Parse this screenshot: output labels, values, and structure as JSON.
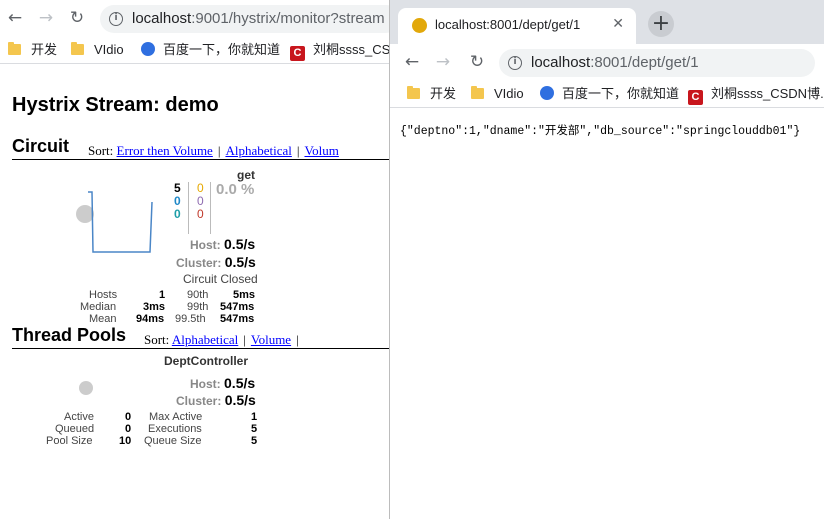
{
  "left_browser": {
    "url_host": "localhost",
    "url_rest": ":9001/hystrix/monitor?stream",
    "bookmarks": [
      "开发",
      "VIdio",
      "百度一下，你就知道",
      "刘桐ssss_CSD"
    ]
  },
  "right_browser": {
    "tab_title": "localhost:8001/dept/get/1",
    "url_host": "localhost",
    "url_rest": ":8001/dept/get/1",
    "bookmarks": [
      "开发",
      "VIdio",
      "百度一下，你就知道",
      "刘桐ssss_CSDN博..."
    ],
    "response_body": "{\"deptno\":1,\"dname\":\"开发部\",\"db_source\":\"springclouddb01\"}"
  },
  "dashboard": {
    "title": "Hystrix Stream: demo",
    "circuit": {
      "section_title": "Circuit",
      "sort_label": "Sort:",
      "sort_links": [
        "Error then Volume",
        "Alphabetical",
        "Volum"
      ],
      "name": "get",
      "counts_left": [
        "5",
        "0",
        "0"
      ],
      "counts_right": [
        "0",
        "0",
        "0"
      ],
      "error_pct": "0.0 %",
      "host_label": "Host:",
      "host_rate": "0.5/s",
      "cluster_label": "Cluster:",
      "cluster_rate": "0.5/s",
      "status": "Circuit Closed",
      "stats": {
        "hosts_label": "Hosts",
        "hosts": "1",
        "median_label": "Median",
        "median": "3ms",
        "mean_label": "Mean",
        "mean": "94ms",
        "p90_label": "90th",
        "p90": "5ms",
        "p99_label": "99th",
        "p99": "547ms",
        "p995_label": "99.5th",
        "p995": "547ms"
      }
    },
    "thread_pools": {
      "section_title": "Thread Pools",
      "sort_label": "Sort:",
      "sort_links": [
        "Alphabetical",
        "Volume"
      ],
      "name": "DeptController",
      "host_label": "Host:",
      "host_rate": "0.5/s",
      "cluster_label": "Cluster:",
      "cluster_rate": "0.5/s",
      "stats": {
        "active_label": "Active",
        "active": "0",
        "queued_label": "Queued",
        "queued": "0",
        "pool_size_label": "Pool Size",
        "pool_size": "10",
        "max_active_label": "Max Active",
        "max_active": "1",
        "executions_label": "Executions",
        "executions": "5",
        "queue_size_label": "Queue Size",
        "queue_size": "5"
      }
    }
  },
  "colors": {
    "count_success": "#000000",
    "count_blue": "#1e88c7",
    "count_teal": "#1e9ea8",
    "count_orange": "#e6a800",
    "count_purple": "#8e6bb0",
    "count_red": "#c0392b",
    "circle": "#cccccc"
  }
}
